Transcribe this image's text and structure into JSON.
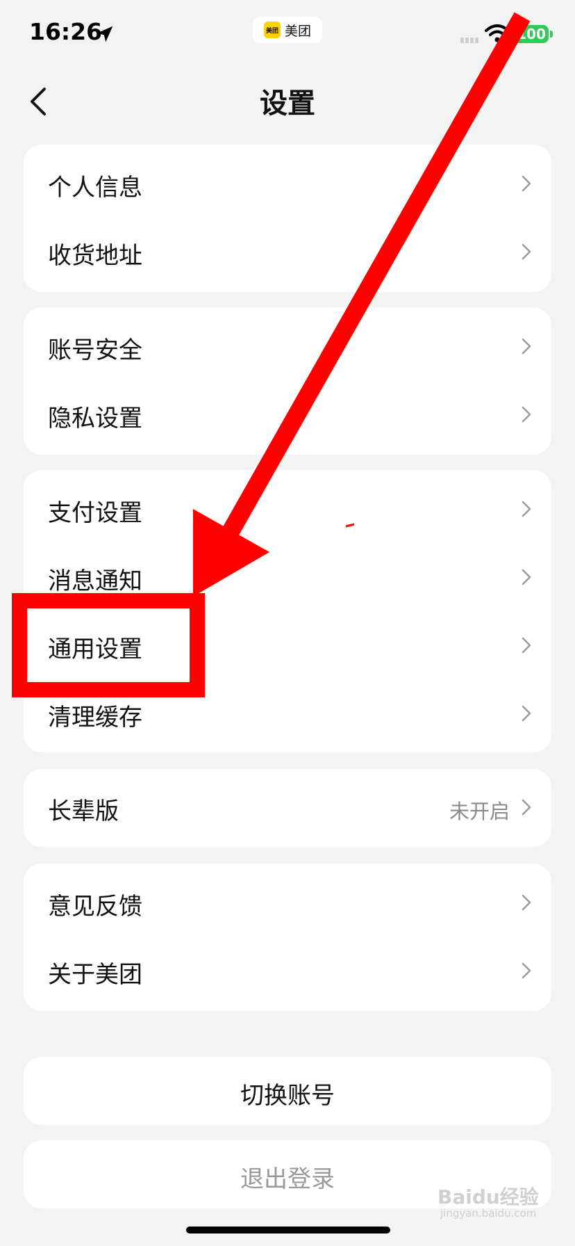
{
  "status_bar": {
    "time": "16:26",
    "app_name": "美团",
    "app_logo_text": "美团",
    "battery": "100",
    "icons": [
      "location-arrow-icon",
      "signal-icon",
      "wifi-icon",
      "battery-icon"
    ]
  },
  "nav": {
    "title": "设置",
    "back_icon": "chevron-left-icon"
  },
  "groups": [
    {
      "rows": [
        {
          "label": "个人信息"
        },
        {
          "label": "收货地址"
        }
      ]
    },
    {
      "rows": [
        {
          "label": "账号安全"
        },
        {
          "label": "隐私设置"
        }
      ]
    },
    {
      "rows": [
        {
          "label": "支付设置"
        },
        {
          "label": "消息通知"
        },
        {
          "label": "通用设置"
        },
        {
          "label": "清理缓存"
        }
      ]
    },
    {
      "rows": [
        {
          "label": "长辈版",
          "value": "未开启"
        }
      ]
    },
    {
      "rows": [
        {
          "label": "意见反馈"
        },
        {
          "label": "关于美团"
        }
      ]
    }
  ],
  "actions": {
    "switch_account": "切换账号",
    "logout": "退出登录"
  },
  "annotation": {
    "highlighted_item": "通用设置",
    "color": "#ff0000"
  },
  "watermark": {
    "text": "Baidu经验",
    "sub": "jingyan.baidu.com"
  }
}
